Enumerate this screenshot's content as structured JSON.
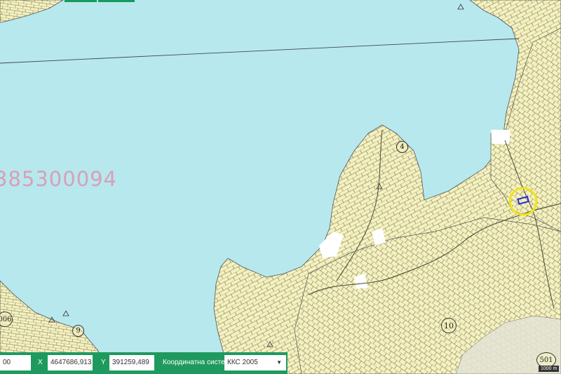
{
  "map": {
    "parcel_label": "385300094",
    "district_numbers": [
      "4",
      "9",
      "10",
      "006",
      "501"
    ],
    "colors": {
      "water": "#b7e8ee",
      "land": "#f5f1be",
      "parcel_line": "#6b6b55",
      "highlight_circle": "#f2e31a",
      "selected_parcel": "#2a2ad0",
      "ui_green": "#1f9a5e"
    }
  },
  "coords": {
    "zoom_value": "00",
    "x_label": "X",
    "x_value": "4647686,913",
    "y_label": "Y",
    "y_value": "391259,489",
    "crs_label": "Координатна система",
    "crs_value": "ККС 2005"
  },
  "scale_text": "1000 m"
}
